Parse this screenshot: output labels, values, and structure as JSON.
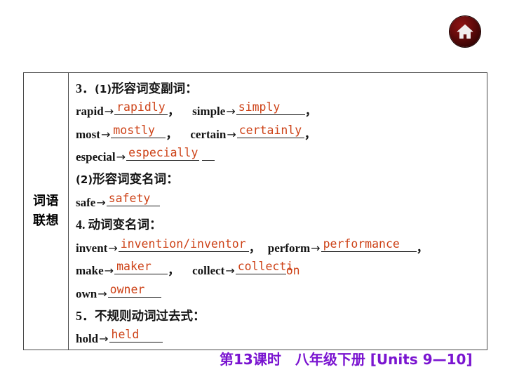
{
  "header": {
    "home_icon": "home-icon"
  },
  "table": {
    "label": {
      "line1": "词语",
      "line2": "联想"
    },
    "sections": [
      {
        "heading_num": "3．",
        "heading_sub": "(1)",
        "heading_text": "形容词变副词："
      },
      {
        "heading_num": "",
        "heading_sub": "(2)",
        "heading_text": "形容词变名词："
      },
      {
        "heading_num": "4.",
        "heading_sub": "",
        "heading_text": "动词变名词："
      },
      {
        "heading_num": "5．",
        "heading_sub": "",
        "heading_text": "不规则动词过去式："
      }
    ],
    "rows": {
      "r1": {
        "w1": "rapid",
        "a1": "rapidly",
        "w2": "simple",
        "a2": "simply"
      },
      "r2": {
        "w1": "most",
        "a1": "mostly",
        "w2": "certain",
        "a2": "certainly"
      },
      "r3": {
        "w1": "especial",
        "a1": "especially"
      },
      "r4": {
        "w1": "safe",
        "a1": "safety"
      },
      "r5": {
        "w1": "invent",
        "a1": "invention/inventor",
        "w2": "perform",
        "a2": "performance"
      },
      "r6": {
        "w1": "make",
        "a1": "maker",
        "w2": "collect",
        "a2": "collecti",
        "a2_overflow": "on"
      },
      "r7": {
        "w1": "own",
        "a1": "owner"
      },
      "r8": {
        "w1": "hold",
        "a1": "held"
      }
    },
    "arrow": "→",
    "comma": "，"
  },
  "banner": {
    "text": "第13课时　八年级下册 [Units 9—10]"
  },
  "colors": {
    "answer": "#cd4217",
    "banner": "#7a14d0",
    "icon_bg": "#6b0d0d",
    "border": "#4a4a4a"
  }
}
